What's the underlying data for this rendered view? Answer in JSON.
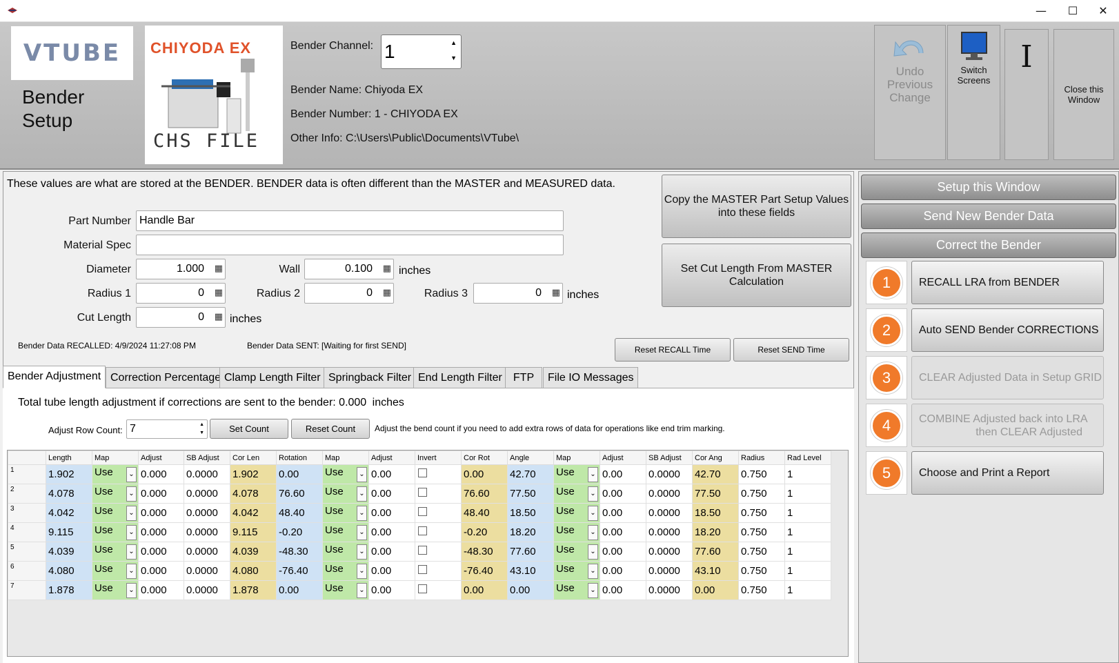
{
  "window": {
    "minimize": "—",
    "maximize": "☐",
    "close": "✕"
  },
  "header": {
    "title_line1": "Bender",
    "title_line2": "Setup",
    "logo_text": "VTUBE",
    "machine_brand": "CHIYODA EX",
    "machine_file": "CHS FILE",
    "channel_label": "Bender Channel:",
    "channel_value": "1",
    "bender_name": "Bender Name: Chiyoda EX",
    "bender_number": "Bender Number: 1 - CHIYODA EX",
    "other_info": "Other Info: C:\\Users\\Public\\Documents\\VTube\\"
  },
  "toolbar": {
    "undo_l1": "Undo",
    "undo_l2": "Previous",
    "undo_l3": "Change",
    "switch_l1": "Switch",
    "switch_l2": "Screens",
    "cursor": "I",
    "close_l1": "Close this",
    "close_l2": "Window"
  },
  "form": {
    "intro": "These values are what are stored at the BENDER.  BENDER data is often different than the MASTER and MEASURED data.",
    "part_number_label": "Part Number",
    "part_number": "Handle Bar",
    "material_label": "Material Spec",
    "material": "",
    "diameter_label": "Diameter",
    "diameter": "1.000",
    "wall_label": "Wall",
    "wall": "0.100",
    "inches": "inches",
    "radius1_label": "Radius 1",
    "radius1": "0",
    "radius2_label": "Radius 2",
    "radius2": "0",
    "radius3_label": "Radius 3",
    "radius3": "0",
    "cut_label": "Cut Length",
    "cut": "0",
    "recalled": "Bender Data RECALLED:  4/9/2024 11:27:08 PM",
    "sent": "Bender Data SENT:  [Waiting for first SEND]",
    "copy_btn_l1": "Copy the MASTER Part Setup Values",
    "copy_btn_l2": "into these fields",
    "cutbtn_l1": "Set Cut Length From MASTER",
    "cutbtn_l2": "Calculation",
    "reset_recall": "Reset RECALL Time",
    "reset_send": "Reset SEND Time"
  },
  "tabs": [
    "Bender Adjustment",
    "Correction Percentage",
    "Clamp Length Filter",
    "Springback Filter",
    "End Length Filter",
    "FTP",
    "File IO Messages"
  ],
  "adjust": {
    "total": "Total tube length adjustment if corrections are sent to the bender: 0.000",
    "inches": "inches",
    "row_count_label": "Adjust Row Count:",
    "row_count": "7",
    "set_count": "Set Count",
    "reset_count": "Reset Count",
    "hint": "Adjust the bend count if you need to add extra rows of data for operations like end trim marking."
  },
  "grid": {
    "columns": [
      "Length",
      "Map",
      "Adjust",
      "SB Adjust",
      "Cor Len",
      "Rotation",
      "Map",
      "Adjust",
      "Invert",
      "Cor Rot",
      "Angle",
      "Map",
      "Adjust",
      "SB Adjust",
      "Cor Ang",
      "Radius",
      "Rad Level"
    ],
    "rows": [
      [
        "1",
        "1.902",
        "Use",
        "0.000",
        "0.0000",
        "1.902",
        "0.00",
        "Use",
        "0.00",
        "",
        "0.00",
        "42.70",
        "Use",
        "0.00",
        "0.0000",
        "42.70",
        "0.750",
        "1"
      ],
      [
        "2",
        "4.078",
        "Use",
        "0.000",
        "0.0000",
        "4.078",
        "76.60",
        "Use",
        "0.00",
        "",
        "76.60",
        "77.50",
        "Use",
        "0.00",
        "0.0000",
        "77.50",
        "0.750",
        "1"
      ],
      [
        "3",
        "4.042",
        "Use",
        "0.000",
        "0.0000",
        "4.042",
        "48.40",
        "Use",
        "0.00",
        "",
        "48.40",
        "18.50",
        "Use",
        "0.00",
        "0.0000",
        "18.50",
        "0.750",
        "1"
      ],
      [
        "4",
        "9.115",
        "Use",
        "0.000",
        "0.0000",
        "9.115",
        "-0.20",
        "Use",
        "0.00",
        "",
        "-0.20",
        "18.20",
        "Use",
        "0.00",
        "0.0000",
        "18.20",
        "0.750",
        "1"
      ],
      [
        "5",
        "4.039",
        "Use",
        "0.000",
        "0.0000",
        "4.039",
        "-48.30",
        "Use",
        "0.00",
        "",
        "-48.30",
        "77.60",
        "Use",
        "0.00",
        "0.0000",
        "77.60",
        "0.750",
        "1"
      ],
      [
        "6",
        "4.080",
        "Use",
        "0.000",
        "0.0000",
        "4.080",
        "-76.40",
        "Use",
        "0.00",
        "",
        "-76.40",
        "43.10",
        "Use",
        "0.00",
        "0.0000",
        "43.10",
        "0.750",
        "1"
      ],
      [
        "7",
        "1.878",
        "Use",
        "0.000",
        "0.0000",
        "1.878",
        "0.00",
        "Use",
        "0.00",
        "",
        "0.00",
        "0.00",
        "Use",
        "0.00",
        "0.0000",
        "0.00",
        "0.750",
        "1"
      ]
    ]
  },
  "right": {
    "setup": "Setup this Window",
    "send": "Send New Bender Data",
    "correct": "Correct the Bender",
    "steps": [
      {
        "n": "1",
        "l1": "RECALL LRA from BENDER",
        "l2": "",
        "enabled": true
      },
      {
        "n": "2",
        "l1": "Auto SEND Bender CORRECTIONS",
        "l2": "",
        "enabled": true
      },
      {
        "n": "3",
        "l1": "CLEAR Adjusted Data in Setup GRID",
        "l2": "",
        "enabled": false
      },
      {
        "n": "4",
        "l1": "COMBINE Adjusted back into LRA",
        "l2": "then CLEAR Adjusted",
        "enabled": false
      },
      {
        "n": "5",
        "l1": "Choose and Print a Report",
        "l2": "",
        "enabled": true
      }
    ]
  },
  "colors": {
    "accent": "#f07a2a",
    "cell_blue": "#cfe2f5",
    "cell_green": "#bfe8a8",
    "cell_yellow": "#ecdea0"
  }
}
